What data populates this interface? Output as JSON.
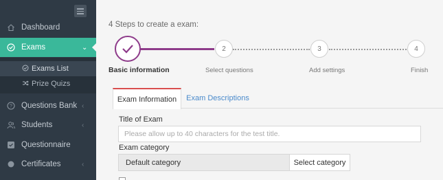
{
  "sidebar": {
    "items": [
      {
        "label": "Dashboard",
        "icon": "home-icon"
      },
      {
        "label": "Exams",
        "icon": "check-circle-icon",
        "active": true
      },
      {
        "label": "Questions Bank",
        "icon": "question-circle-icon"
      },
      {
        "label": "Students",
        "icon": "users-icon"
      },
      {
        "label": "Questionnaire",
        "icon": "checkbox-icon"
      },
      {
        "label": "Certificates",
        "icon": "circle-icon"
      }
    ],
    "sub_items": [
      {
        "label": "Exams List",
        "icon": "check-circle-icon",
        "selected": true
      },
      {
        "label": "Prize Quizs",
        "icon": "shuffle-icon"
      }
    ]
  },
  "wizard": {
    "title": "4 Steps to create a exam:",
    "steps": [
      {
        "number": "",
        "label": "Basic information",
        "state": "completed"
      },
      {
        "number": "2",
        "label": "Select questions",
        "state": "pending"
      },
      {
        "number": "3",
        "label": "Add settings",
        "state": "pending"
      },
      {
        "number": "4",
        "label": "Finish",
        "state": "pending"
      }
    ]
  },
  "tabs": [
    {
      "label": "Exam Information",
      "active": true
    },
    {
      "label": "Exam Descriptions",
      "active": false
    }
  ],
  "form": {
    "title_label": "Title of Exam",
    "title_value": "",
    "title_placeholder": "Please allow up to 40 characters for the test title.",
    "category_label": "Exam category",
    "category_value": "Default category",
    "select_category_label": "Select category"
  },
  "colors": {
    "sidebar_bg": "#2f3a45",
    "accent_green": "#3ab89a",
    "step_purple": "#8e3b8a",
    "tab_red": "#d84d4d",
    "link_blue": "#4a8acb"
  }
}
